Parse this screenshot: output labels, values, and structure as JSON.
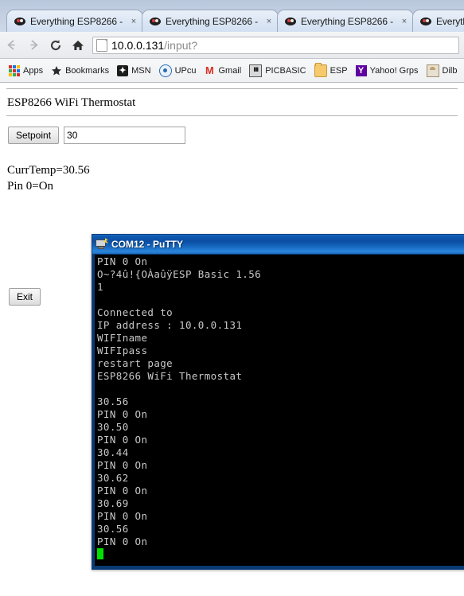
{
  "browser": {
    "tabs": [
      {
        "title": "Everything ESP8266 -",
        "favicon": "esp8266-favicon",
        "close": "×"
      },
      {
        "title": "Everything ESP8266 -",
        "favicon": "esp8266-favicon",
        "close": "×"
      },
      {
        "title": "Everything ESP8266 -",
        "favicon": "esp8266-favicon",
        "close": "×"
      },
      {
        "title": "Everything",
        "favicon": "esp8266-favicon",
        "close": ""
      }
    ],
    "nav": {
      "back_icon": "back-arrow-icon",
      "forward_icon": "forward-arrow-icon",
      "reload_icon": "reload-icon",
      "home_icon": "home-icon"
    },
    "omnibox": {
      "host": "10.0.0.131",
      "path": "/input?",
      "full_url": "10.0.0.131/input?"
    },
    "bookmarks": [
      {
        "label": "Apps",
        "icon": "apps-grid-icon"
      },
      {
        "label": "Bookmarks",
        "icon": "star-icon"
      },
      {
        "label": "MSN",
        "icon": "msn-icon"
      },
      {
        "label": "UPcu",
        "icon": "upcu-icon"
      },
      {
        "label": "Gmail",
        "icon": "gmail-icon"
      },
      {
        "label": "PICBASIC",
        "icon": "picbasic-icon"
      },
      {
        "label": "ESP",
        "icon": "folder-icon"
      },
      {
        "label": "Yahoo! Grps",
        "icon": "yahoo-icon"
      },
      {
        "label": "Dilb",
        "icon": "dilbert-icon"
      }
    ]
  },
  "page": {
    "title": "ESP8266 WiFi Thermostat",
    "setpoint_button": "Setpoint",
    "setpoint_value": "30",
    "curr_temp_line": "CurrTemp=30.56",
    "pin_line": "Pin 0=On",
    "exit_button": "Exit"
  },
  "putty": {
    "title": "COM12 - PuTTY",
    "icon": "putty-computer-icon",
    "lines": [
      "PIN 0 On",
      "O~?4û!{OÀaûÿESP Basic 1.56",
      "1",
      "",
      "Connected to",
      "IP address : 10.0.0.131",
      "WIFIname",
      "WIFIpass",
      "restart page",
      "ESP8266 WiFi Thermostat",
      "",
      "30.56",
      "PIN 0 On",
      "30.50",
      "PIN 0 On",
      "30.44",
      "PIN 0 On",
      "30.62",
      "PIN 0 On",
      "30.69",
      "PIN 0 On",
      "30.56",
      "PIN 0 On"
    ],
    "cursor": "block-cursor"
  },
  "colors": {
    "tabstrip": "#c6d2e3",
    "putty_title_blue": "#0b4ea3",
    "terminal_bg": "#000000",
    "terminal_fg": "#c8c8c8",
    "cursor_green": "#00e000",
    "gmail_red": "#d93025",
    "yahoo_purple": "#5f01a0"
  }
}
